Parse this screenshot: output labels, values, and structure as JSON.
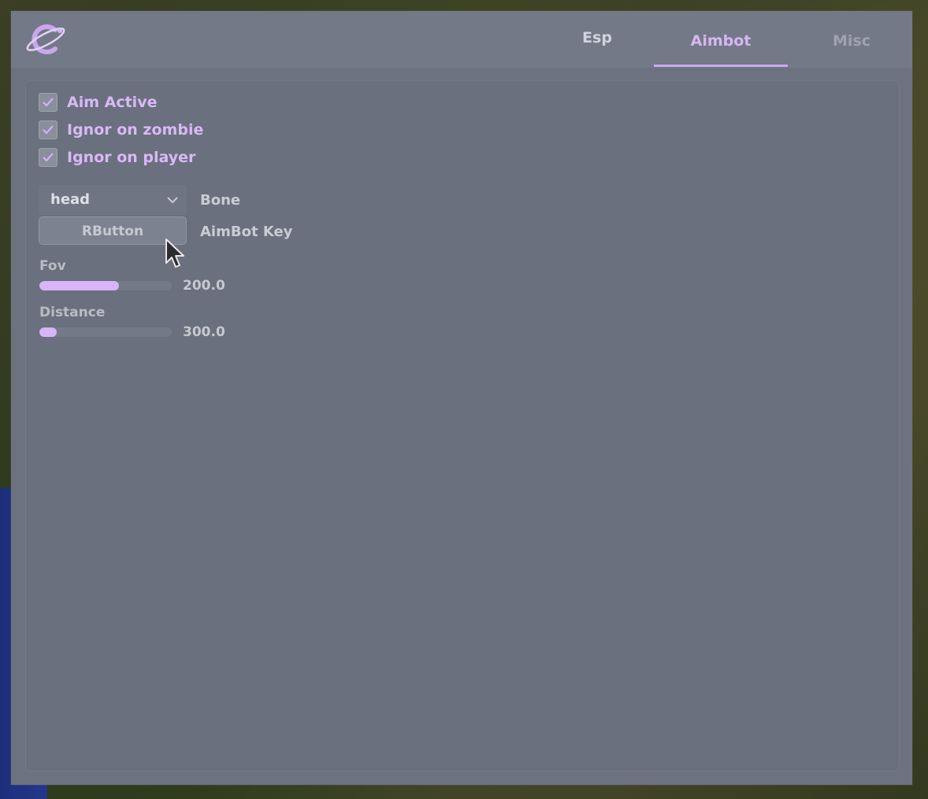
{
  "tabs": {
    "esp": "Esp",
    "aimbot": "Aimbot",
    "misc": "Misc",
    "active": "Aimbot"
  },
  "checkboxes": [
    {
      "label": "Aim Active",
      "checked": true
    },
    {
      "label": "Ignor on zombie",
      "checked": true
    },
    {
      "label": "Ignor on player",
      "checked": true
    }
  ],
  "bone": {
    "selected": "head",
    "label": "Bone"
  },
  "aimbot_key": {
    "button_label": "RButton",
    "label": "AimBot Key"
  },
  "sliders": {
    "fov": {
      "title": "Fov",
      "value_text": "200.0",
      "fill_fraction": 0.6
    },
    "distance": {
      "title": "Distance",
      "value_text": "300.0",
      "fill_fraction": 0.13
    }
  },
  "colors": {
    "accent": "#d8b4f8",
    "panel": "#6a707d",
    "titlebar": "#737987"
  },
  "icons": {
    "logo": "planet-logo-icon",
    "check": "check-icon",
    "chevron": "chevron-down-icon",
    "cursor": "mouse-cursor-icon"
  }
}
